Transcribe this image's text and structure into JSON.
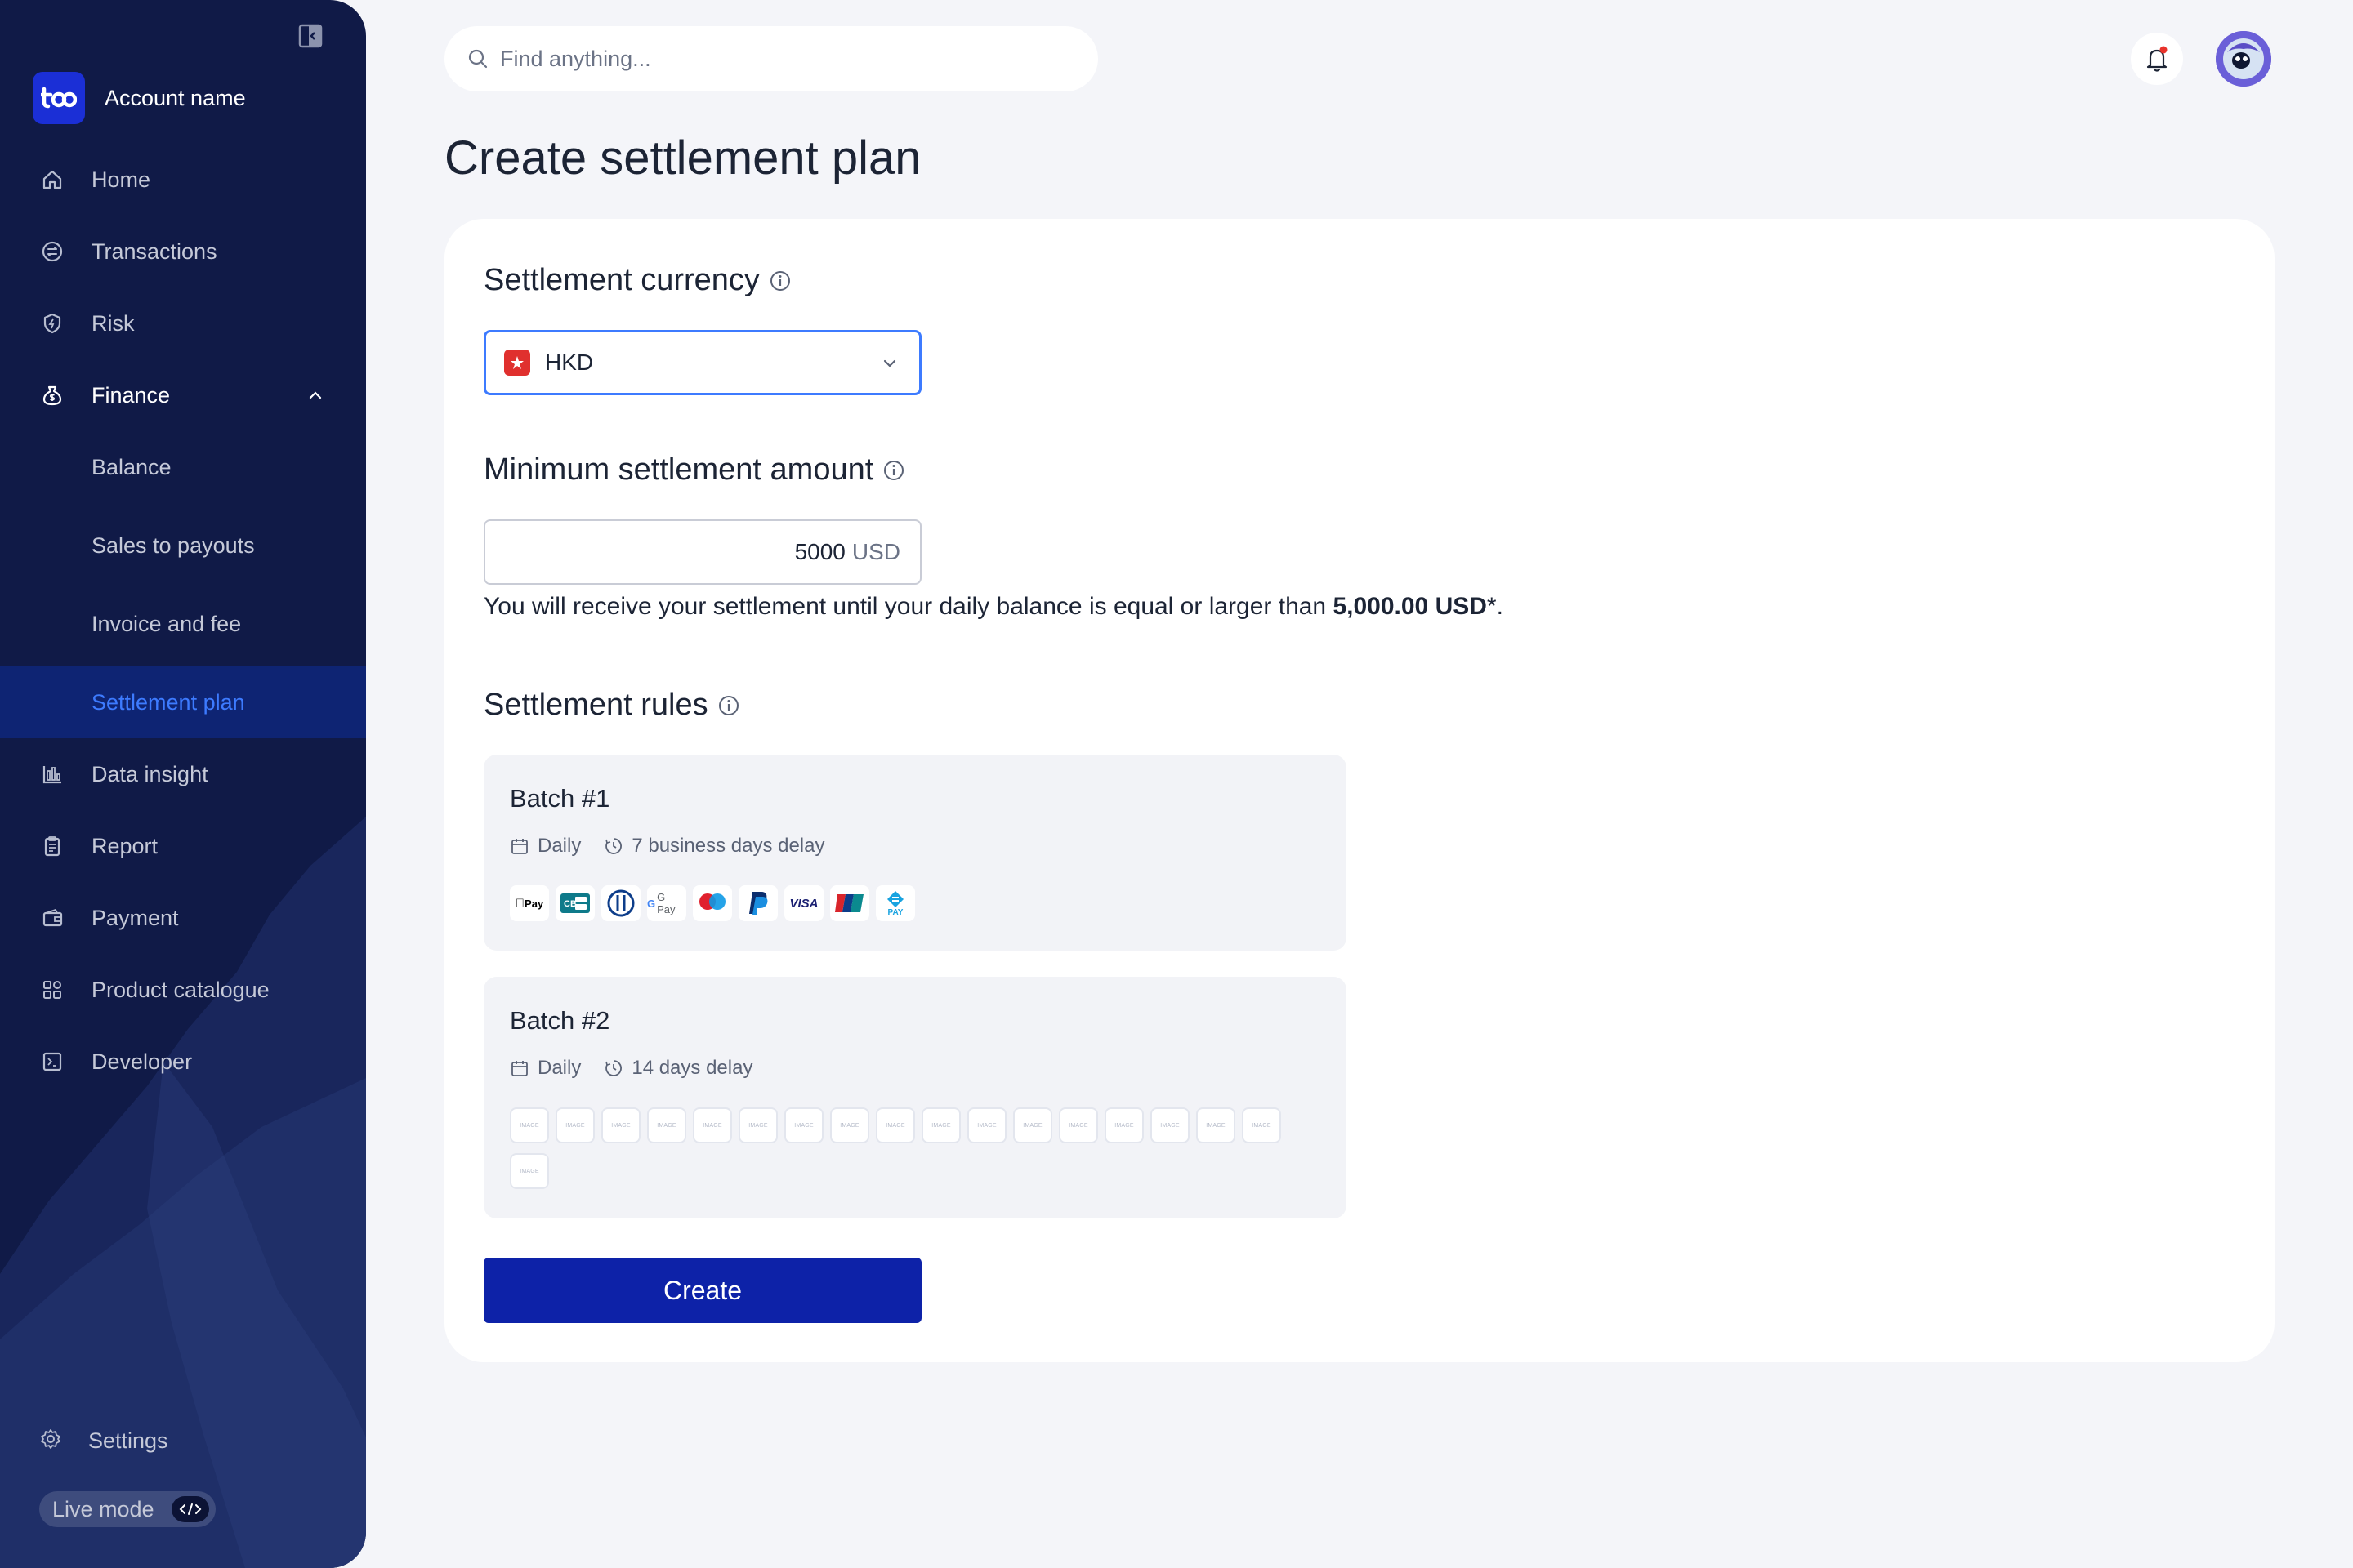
{
  "sidebar": {
    "account_name": "Account name",
    "items": [
      {
        "label": "Home",
        "icon": "home-icon"
      },
      {
        "label": "Transactions",
        "icon": "transactions-icon"
      },
      {
        "label": "Risk",
        "icon": "shield-icon"
      },
      {
        "label": "Finance",
        "icon": "money-bag-icon"
      },
      {
        "label": "Balance"
      },
      {
        "label": "Sales to payouts"
      },
      {
        "label": "Invoice and fee"
      },
      {
        "label": "Settlement plan"
      },
      {
        "label": "Data insight",
        "icon": "bar-chart-icon"
      },
      {
        "label": "Report",
        "icon": "clipboard-icon"
      },
      {
        "label": "Payment",
        "icon": "wallet-icon"
      },
      {
        "label": "Product catalogue",
        "icon": "grid-icon"
      },
      {
        "label": "Developer",
        "icon": "terminal-icon"
      }
    ],
    "settings_label": "Settings",
    "live_mode_label": "Live mode",
    "active_item": "Settlement plan",
    "accent_color": "#3d7bff"
  },
  "search": {
    "placeholder": "Find anything..."
  },
  "page": {
    "title": "Create settlement plan"
  },
  "form": {
    "currency": {
      "title": "Settlement currency",
      "selected": "HKD"
    },
    "minimum": {
      "title": "Minimum settlement amount",
      "value": "5000",
      "unit": "USD",
      "helper_prefix": "You will receive your settlement until your daily balance is equal or larger than ",
      "helper_amount": "5,000.00 USD",
      "helper_suffix": "*."
    },
    "rules": {
      "title": "Settlement rules",
      "batches": [
        {
          "title": "Batch #1",
          "frequency": "Daily",
          "delay": "7 business days delay",
          "payment_methods": [
            "Pay",
            "CB",
            "Diners",
            "G Pay",
            "Maestro",
            "PayPal",
            "VISA",
            "UnionPay",
            "PAY"
          ]
        },
        {
          "title": "Batch #2",
          "frequency": "Daily",
          "delay": "14 days delay",
          "placeholder_label": "IMAGE"
        }
      ]
    },
    "create_label": "Create",
    "button_color": "#0d22a8"
  }
}
